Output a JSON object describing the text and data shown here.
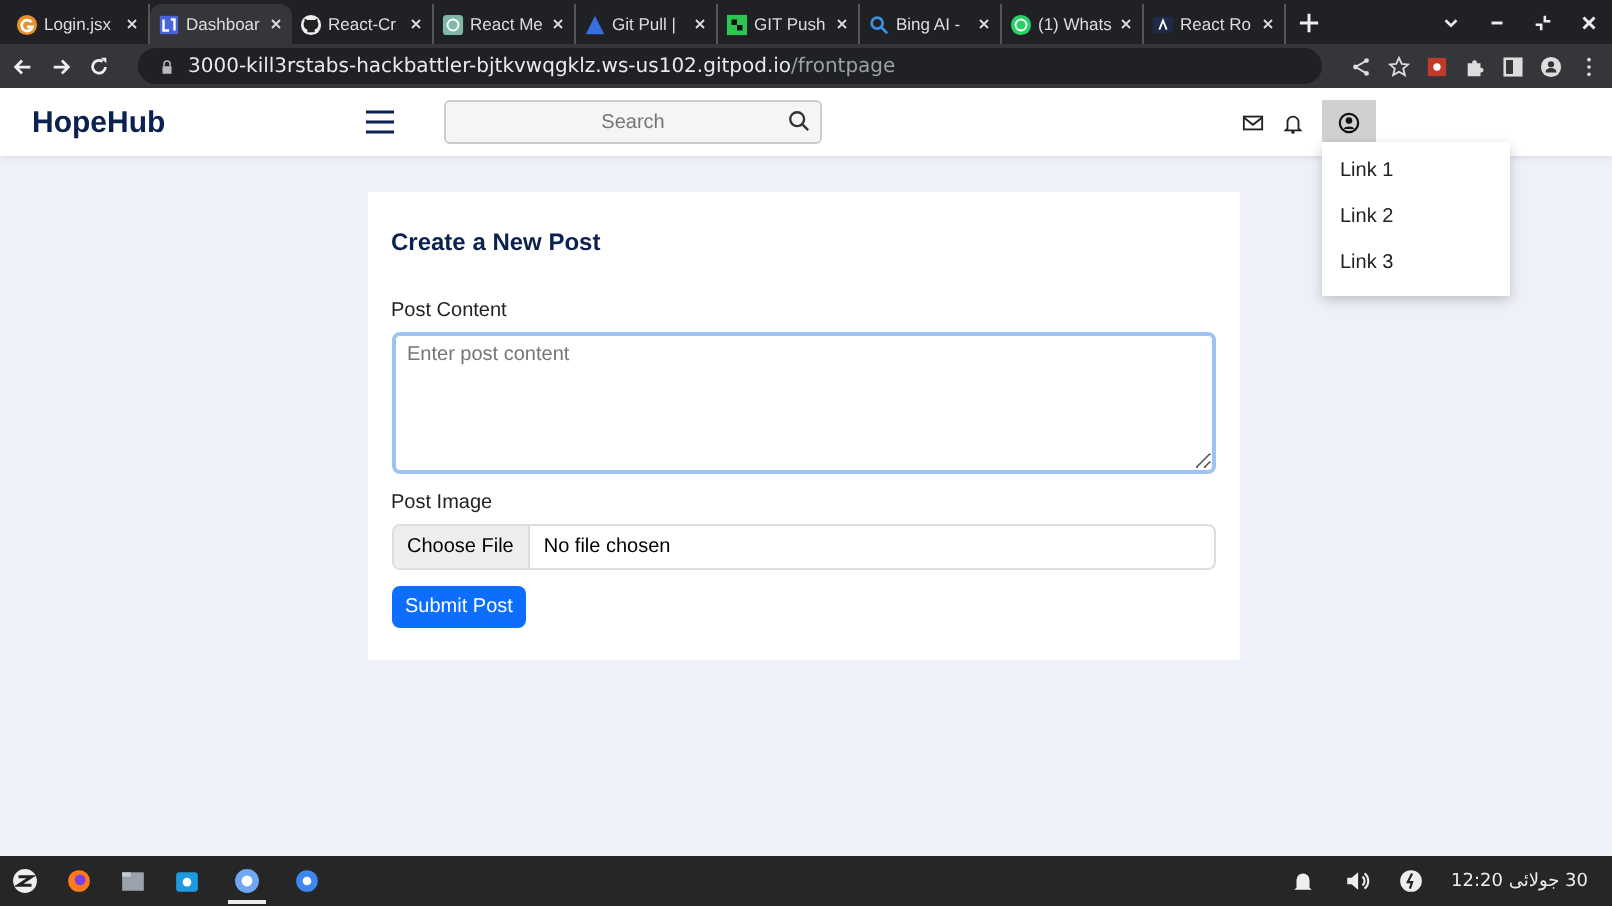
{
  "browser": {
    "tabs": [
      {
        "title": "Login.jsx",
        "selected": false
      },
      {
        "title": "Dashboar",
        "selected": true
      },
      {
        "title": "React-Cr",
        "selected": false
      },
      {
        "title": "React Me",
        "selected": false
      },
      {
        "title": "Git Pull |",
        "selected": false
      },
      {
        "title": "GIT Push",
        "selected": false
      },
      {
        "title": "Bing AI -",
        "selected": false
      },
      {
        "title": "(1) Whats",
        "selected": false
      },
      {
        "title": "React Ro",
        "selected": false
      }
    ],
    "url_host": "3000-kill3rstabs-hackbattler-bjtkvwqgklz.ws-us102.gitpod.io",
    "url_path": "/frontpage"
  },
  "app": {
    "brand": "HopeHub",
    "search": {
      "placeholder": "Search"
    },
    "menu": [
      "Link 1",
      "Link 2",
      "Link 3"
    ],
    "form": {
      "title": "Create a New Post",
      "content_label": "Post Content",
      "content_placeholder": "Enter post content",
      "image_label": "Post Image",
      "file_button": "Choose File",
      "file_status": "No file chosen",
      "submit": "Submit Post"
    }
  },
  "taskbar": {
    "clock": "30 جولائی 12:20"
  }
}
